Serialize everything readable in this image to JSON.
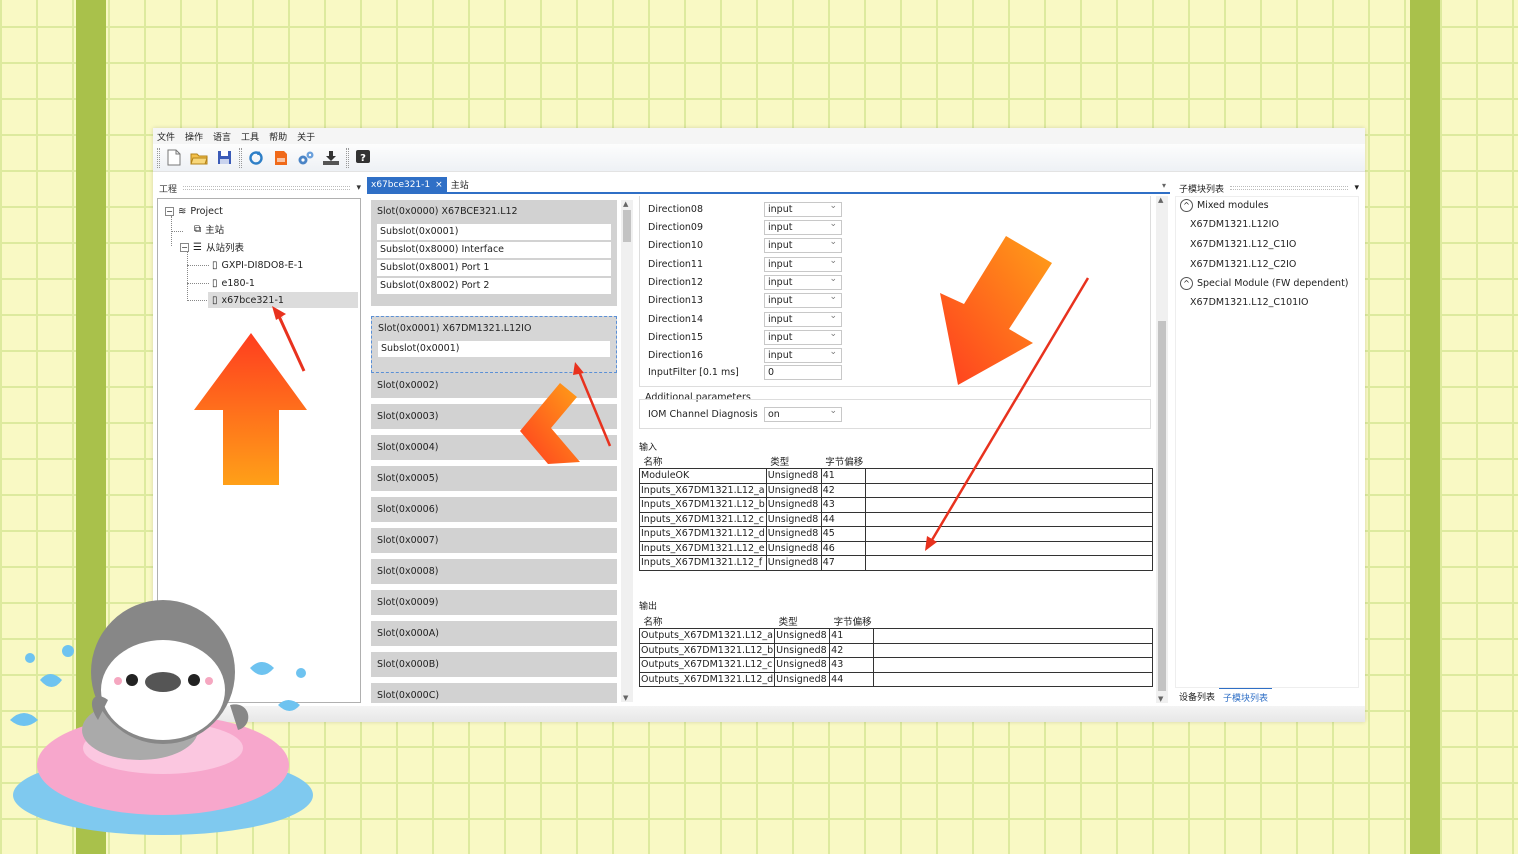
{
  "menu": [
    "文件",
    "操作",
    "语言",
    "工具",
    "帮助",
    "关于"
  ],
  "toolbar_icons": [
    "new-file-icon",
    "open-folder-icon",
    "save-icon",
    "refresh-icon",
    "export-icon",
    "settings-gears-icon",
    "download-icon",
    "help-icon"
  ],
  "project_panel": {
    "title": "工程",
    "tree": {
      "root": "Project",
      "master": "主站",
      "slave_list": "从站列表",
      "slaves": [
        "GXPI-DI8DO8-E-1",
        "e180-1",
        "x67bce321-1"
      ]
    }
  },
  "tabs": [
    {
      "label": "x67bce321-1",
      "close": "×"
    },
    {
      "label": "主站"
    }
  ],
  "slots": {
    "slot0": {
      "title": "Slot(0x0000)    X67BCE321.L12",
      "subslots": [
        "Subslot(0x0001)",
        "Subslot(0x8000)    Interface",
        "Subslot(0x8001)    Port 1",
        "Subslot(0x8002)    Port 2"
      ]
    },
    "slot1": {
      "title": "Slot(0x0001)    X67DM1321.L12IO",
      "subslots": [
        "Subslot(0x0001)"
      ]
    },
    "others": [
      "Slot(0x0002)",
      "Slot(0x0003)",
      "Slot(0x0004)",
      "Slot(0x0005)",
      "Slot(0x0006)",
      "Slot(0x0007)",
      "Slot(0x0008)",
      "Slot(0x0009)",
      "Slot(0x000A)",
      "Slot(0x000B)",
      "Slot(0x000C)"
    ]
  },
  "parameters": {
    "directions": [
      {
        "label": "Direction08",
        "value": "input"
      },
      {
        "label": "Direction09",
        "value": "input"
      },
      {
        "label": "Direction10",
        "value": "input"
      },
      {
        "label": "Direction11",
        "value": "input"
      },
      {
        "label": "Direction12",
        "value": "input"
      },
      {
        "label": "Direction13",
        "value": "input"
      },
      {
        "label": "Direction14",
        "value": "input"
      },
      {
        "label": "Direction15",
        "value": "input"
      },
      {
        "label": "Direction16",
        "value": "input"
      }
    ],
    "input_filter": {
      "label": "InputFilter [0.1 ms]",
      "value": "0"
    },
    "additional_title": "Additional parameters",
    "iom_diag": {
      "label": "IOM Channel Diagnosis",
      "value": "on"
    }
  },
  "inputs": {
    "section_label": "输入",
    "headers": [
      "名称",
      "类型",
      "字节偏移"
    ],
    "rows": [
      [
        "ModuleOK",
        "Unsigned8",
        "41"
      ],
      [
        "Inputs_X67DM1321.L12_a",
        "Unsigned8",
        "42"
      ],
      [
        "Inputs_X67DM1321.L12_b",
        "Unsigned8",
        "43"
      ],
      [
        "Inputs_X67DM1321.L12_c",
        "Unsigned8",
        "44"
      ],
      [
        "Inputs_X67DM1321.L12_d",
        "Unsigned8",
        "45"
      ],
      [
        "Inputs_X67DM1321.L12_e",
        "Unsigned8",
        "46"
      ],
      [
        "Inputs_X67DM1321.L12_f",
        "Unsigned8",
        "47"
      ]
    ]
  },
  "outputs": {
    "section_label": "输出",
    "headers": [
      "名称",
      "类型",
      "字节偏移"
    ],
    "rows": [
      [
        "Outputs_X67DM1321.L12_a",
        "Unsigned8",
        "41"
      ],
      [
        "Outputs_X67DM1321.L12_b",
        "Unsigned8",
        "42"
      ],
      [
        "Outputs_X67DM1321.L12_c",
        "Unsigned8",
        "43"
      ],
      [
        "Outputs_X67DM1321.L12_d",
        "Unsigned8",
        "44"
      ]
    ]
  },
  "submodule_panel": {
    "title": "子模块列表",
    "groups": [
      {
        "name": "Mixed modules",
        "items": [
          "X67DM1321.L12IO",
          "X67DM1321.L12_C1IO",
          "X67DM1321.L12_C2IO"
        ]
      },
      {
        "name": "Special Module (FW dependent)",
        "items": [
          "X67DM1321.L12_C101IO"
        ]
      }
    ],
    "bottom_tabs": [
      "设备列表",
      "子模块列表"
    ]
  },
  "colors": {
    "background": "#f9f9c4",
    "grid": "#ddea9e",
    "side_bar": "#a9c14b",
    "tab_active": "#2f6fc6",
    "arrow_orange": "#ff6a13",
    "annotation_red": "#e8321e"
  }
}
